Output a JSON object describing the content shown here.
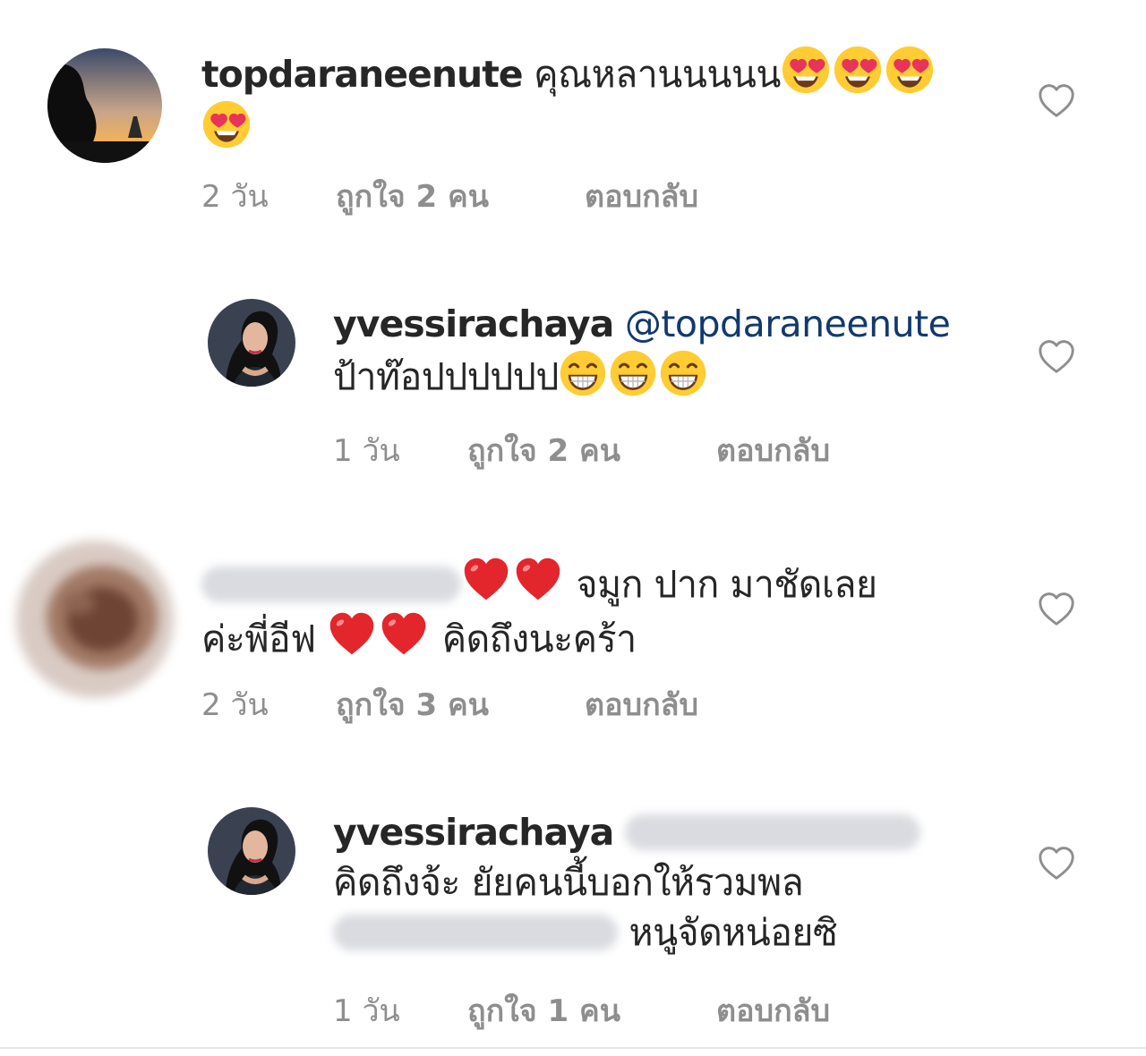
{
  "comments": [
    {
      "username": "topdaraneenute",
      "text": "คุณหลานนนนน",
      "time": "2 วัน",
      "likes": "ถูกใจ 2 คน",
      "reply": "ตอบกลับ"
    },
    {
      "username": "yvessirachaya",
      "mention": "@topdaraneenute",
      "text": "ป้าท๊อปปปปปป",
      "time": "1 วัน",
      "likes": "ถูกใจ 2 คน",
      "reply": "ตอบกลับ"
    },
    {
      "text_1": "จมูก ปาก มาชัดเลย",
      "text_2": "ค่ะพี่อีฟ",
      "text_3": "คิดถึงนะคร้า",
      "time": "2 วัน",
      "likes": "ถูกใจ 3 คน",
      "reply": "ตอบกลับ"
    },
    {
      "username": "yvessirachaya",
      "text_1": "คิดถึงจ้ะ ยัยคนนี้บอกให้รวมพล",
      "text_2": "หนูจัดหน่อยซิ",
      "time": "1 วัน",
      "likes": "ถูกใจ 1 คน",
      "reply": "ตอบกลับ"
    }
  ],
  "icons": {
    "like": "heart-outline-icon",
    "emoji_1": "heart-eyes-emoji",
    "emoji_2": "grinning-emoji",
    "emoji_3": "red-heart-emoji"
  },
  "colors": {
    "text": "#262626",
    "meta": "#8e8e8e",
    "mention": "#12396f"
  }
}
